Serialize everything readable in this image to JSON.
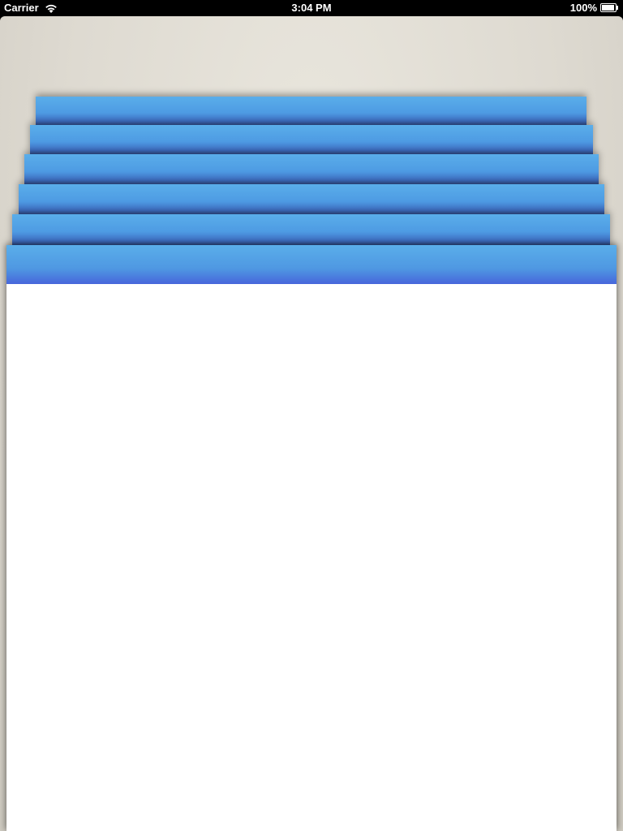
{
  "status_bar": {
    "carrier": "Carrier",
    "time": "3:04 PM",
    "battery": "100%"
  },
  "icons": {
    "wifi": "wifi-icon",
    "battery": "battery-icon"
  },
  "colors": {
    "card_top": "#5aaeea",
    "card_bottom": "#3f6fc4",
    "background": "#dedad1",
    "content": "#ffffff"
  },
  "stack": {
    "card_count": 6
  }
}
